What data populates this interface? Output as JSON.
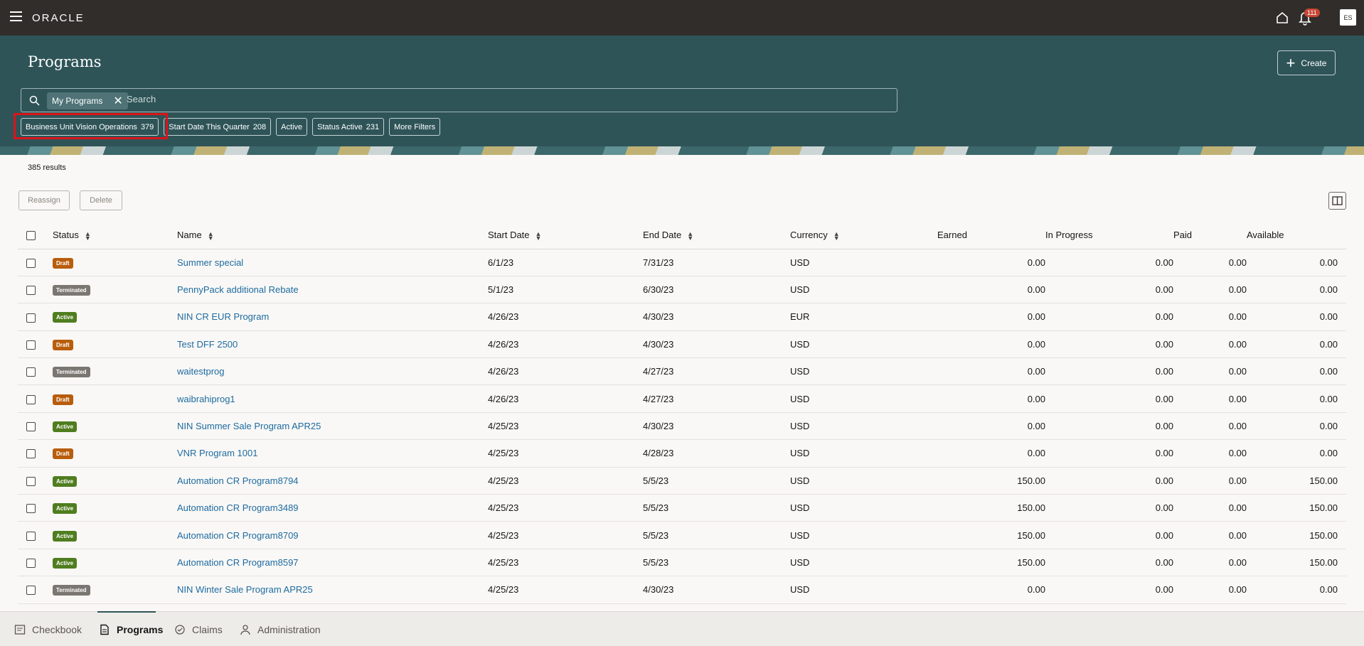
{
  "header": {
    "logo": "ORACLE",
    "notification_count": "111",
    "avatar_initials": "ES"
  },
  "page": {
    "title": "Programs",
    "create_label": "Create"
  },
  "search": {
    "chip_label": "My Programs",
    "placeholder": "Search"
  },
  "filters": [
    {
      "label": "Business Unit Vision Operations",
      "count": "379"
    },
    {
      "label": "Start Date This Quarter",
      "count": "208"
    },
    {
      "label": "Active",
      "count": ""
    },
    {
      "label": "Status Active",
      "count": "231"
    },
    {
      "label": "More Filters",
      "count": ""
    }
  ],
  "results_text": "385 results",
  "actions": {
    "reassign": "Reassign",
    "delete": "Delete"
  },
  "columns": [
    "Status",
    "Name",
    "Start Date",
    "End Date",
    "Currency",
    "Earned",
    "In Progress",
    "Paid",
    "Available"
  ],
  "rows": [
    {
      "status": "Draft",
      "name": "Summer special",
      "start": "6/1/23",
      "end": "7/31/23",
      "currency": "USD",
      "earned": "0.00",
      "in_progress": "0.00",
      "paid": "0.00",
      "available": "0.00"
    },
    {
      "status": "Terminated",
      "name": "PennyPack additional Rebate",
      "start": "5/1/23",
      "end": "6/30/23",
      "currency": "USD",
      "earned": "0.00",
      "in_progress": "0.00",
      "paid": "0.00",
      "available": "0.00"
    },
    {
      "status": "Active",
      "name": "NIN CR EUR Program",
      "start": "4/26/23",
      "end": "4/30/23",
      "currency": "EUR",
      "earned": "0.00",
      "in_progress": "0.00",
      "paid": "0.00",
      "available": "0.00"
    },
    {
      "status": "Draft",
      "name": "Test DFF 2500",
      "start": "4/26/23",
      "end": "4/30/23",
      "currency": "USD",
      "earned": "0.00",
      "in_progress": "0.00",
      "paid": "0.00",
      "available": "0.00"
    },
    {
      "status": "Terminated",
      "name": "waitestprog",
      "start": "4/26/23",
      "end": "4/27/23",
      "currency": "USD",
      "earned": "0.00",
      "in_progress": "0.00",
      "paid": "0.00",
      "available": "0.00"
    },
    {
      "status": "Draft",
      "name": "waibrahiprog1",
      "start": "4/26/23",
      "end": "4/27/23",
      "currency": "USD",
      "earned": "0.00",
      "in_progress": "0.00",
      "paid": "0.00",
      "available": "0.00"
    },
    {
      "status": "Active",
      "name": "NIN Summer Sale Program APR25",
      "start": "4/25/23",
      "end": "4/30/23",
      "currency": "USD",
      "earned": "0.00",
      "in_progress": "0.00",
      "paid": "0.00",
      "available": "0.00"
    },
    {
      "status": "Draft",
      "name": "VNR Program 1001",
      "start": "4/25/23",
      "end": "4/28/23",
      "currency": "USD",
      "earned": "0.00",
      "in_progress": "0.00",
      "paid": "0.00",
      "available": "0.00"
    },
    {
      "status": "Active",
      "name": "Automation CR Program8794",
      "start": "4/25/23",
      "end": "5/5/23",
      "currency": "USD",
      "earned": "150.00",
      "in_progress": "0.00",
      "paid": "0.00",
      "available": "150.00"
    },
    {
      "status": "Active",
      "name": "Automation CR Program3489",
      "start": "4/25/23",
      "end": "5/5/23",
      "currency": "USD",
      "earned": "150.00",
      "in_progress": "0.00",
      "paid": "0.00",
      "available": "150.00"
    },
    {
      "status": "Active",
      "name": "Automation CR Program8709",
      "start": "4/25/23",
      "end": "5/5/23",
      "currency": "USD",
      "earned": "150.00",
      "in_progress": "0.00",
      "paid": "0.00",
      "available": "150.00"
    },
    {
      "status": "Active",
      "name": "Automation CR Program8597",
      "start": "4/25/23",
      "end": "5/5/23",
      "currency": "USD",
      "earned": "150.00",
      "in_progress": "0.00",
      "paid": "0.00",
      "available": "150.00"
    },
    {
      "status": "Terminated",
      "name": "NIN Winter Sale Program APR25",
      "start": "4/25/23",
      "end": "4/30/23",
      "currency": "USD",
      "earned": "0.00",
      "in_progress": "0.00",
      "paid": "0.00",
      "available": "0.00"
    }
  ],
  "bottom_nav": [
    {
      "label": "Checkbook",
      "icon": "checkbook-icon"
    },
    {
      "label": "Programs",
      "icon": "programs-icon"
    },
    {
      "label": "Claims",
      "icon": "claims-icon"
    },
    {
      "label": "Administration",
      "icon": "administration-icon"
    }
  ],
  "colors": {
    "topbar": "#312d2a",
    "banner": "#2f5458",
    "link": "#1e6ba0",
    "draft": "#b85d0c",
    "terminated": "#7a7672",
    "active": "#4f7d1f",
    "highlight": "#d9141b"
  }
}
